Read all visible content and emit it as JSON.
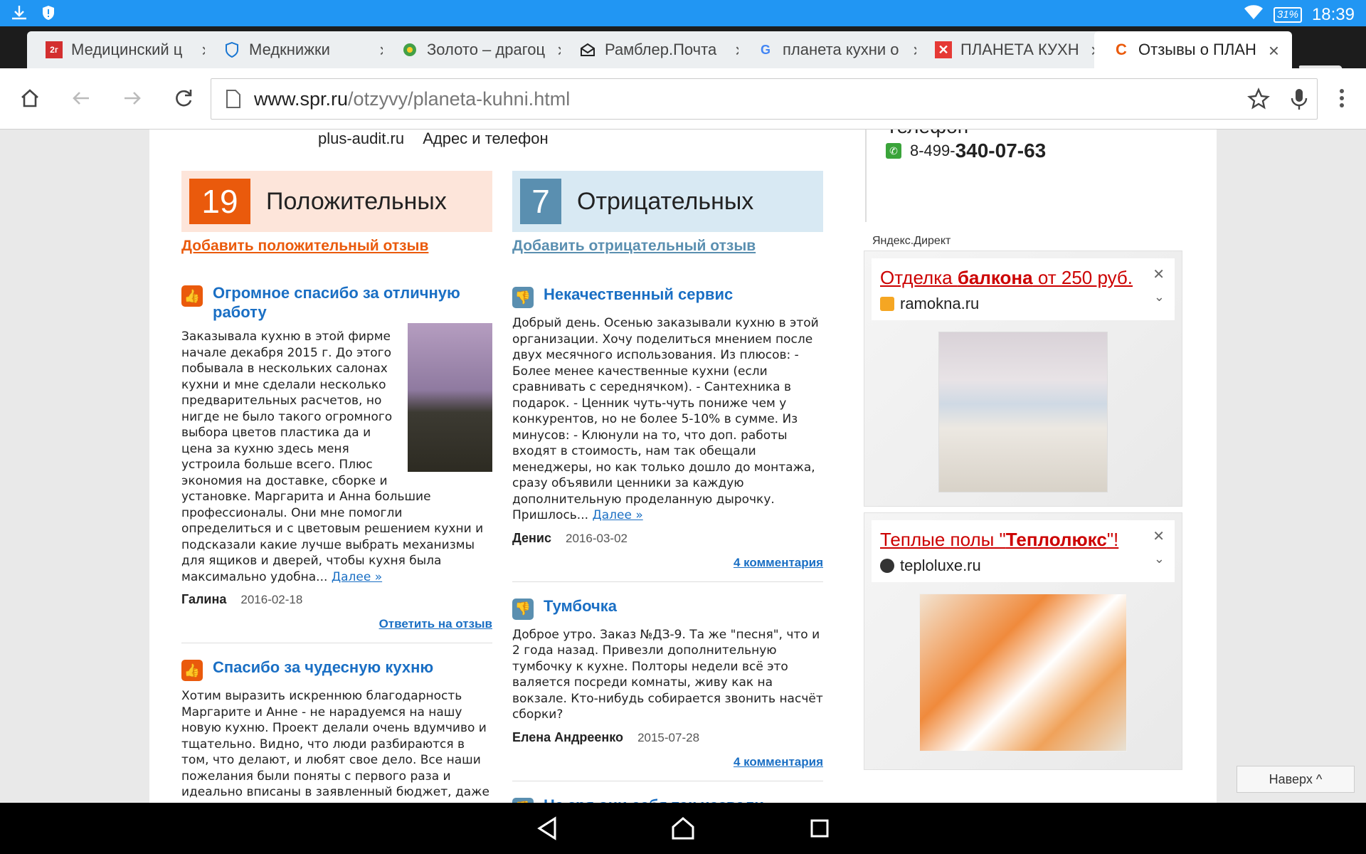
{
  "status": {
    "battery": "31%",
    "time": "18:39"
  },
  "tabs": [
    {
      "title": "Медицинский ц",
      "favicon": "google-2gis-icon"
    },
    {
      "title": "Медкнижки",
      "favicon": "shield-icon"
    },
    {
      "title": "Золото – драгоц",
      "favicon": "gold-icon"
    },
    {
      "title": "Рамблер.Почта",
      "favicon": "mail-icon"
    },
    {
      "title": "планета кухни о",
      "favicon": "google-icon"
    },
    {
      "title": "ПЛАНЕТА КУХН",
      "favicon": "red-x-icon"
    },
    {
      "title": "Отзывы о ПЛАН",
      "favicon": "spr-icon"
    }
  ],
  "omnibox": {
    "domain": "www.spr.ru",
    "path": "/otzyvy/planeta-kuhni.html"
  },
  "page": {
    "top_links": [
      "plus-audit.ru",
      "Адрес и телефон"
    ],
    "phone_label": "Телефон",
    "phone_prefix": "8-499-",
    "phone_main": "340-07-63",
    "positive": {
      "count": "19",
      "label": "Положительных",
      "add_link": "Добавить положительный отзыв"
    },
    "negative": {
      "count": "7",
      "label": "Отрицательных",
      "add_link": "Добавить отрицательный отзыв"
    },
    "positive_reviews": [
      {
        "title": "Огромное спасибо за отличную работу",
        "text": "Заказывала кухню в этой фирме начале декабря 2015 г. До этого побывала в нескольких салонах кухни и мне сделали несколько предварительных расчетов, но нигде не было такого огромного выбора цветов пластика да и цена за кухню здесь меня устроила больше всего. Плюс экономия на доставке, сборке и установке. Маргарита и Анна большие профессионалы. Они мне помогли определиться и с цветовым решением кухни и подсказали какие лучше выбрать механизмы для ящиков и дверей, чтобы кухня была максимально удобна...",
        "more": "Далее »",
        "author": "Галина",
        "date": "2016-02-18",
        "action": "Ответить на отзыв"
      },
      {
        "title": "Спасибо за чудесную кухню",
        "text": "Хотим выразить искреннюю благодарность Маргарите и Анне - не нарадуемся на нашу новую кухню. Проект делали очень вдумчиво и тщательно. Видно, что люди разбираются в том, что делают, и любят свое дело. Все наши пожелания были поняты с первого раза и идеально вписаны в заявленный бюджет, даже"
      }
    ],
    "negative_reviews": [
      {
        "title": "Некачественный сервис",
        "text": "Добрый день. Осенью заказывали кухню в этой организации. Хочу поделиться мнением после двух месячного использования. Из плюсов: - Более менее качественные кухни (если сравнивать с середнячком). - Сантехника в подарок. - Ценник чуть-чуть пониже чем у конкурентов, но не более 5-10% в сумме. Из минусов: - Клюнули на то, что доп. работы входят в стоимость, нам так обещали менеджеры, но как только дошло до монтажа, сразу объявили ценники за каждую дополнительную проделанную дырочку. Пришлось...",
        "more": "Далее »",
        "author": "Денис",
        "date": "2016-03-02",
        "action": "4 комментария"
      },
      {
        "title": "Тумбочка",
        "text": "Доброе утро. Заказ №ДЗ-9. Та же \"песня\", что и 2 года назад. Привезли дополнительную тумбочку к кухне. Полторы недели всё это валяется посреди комнаты, живу как на вокзале. Кто-нибудь собирается звонить насчёт сборки?",
        "author": "Елена Андреенко",
        "date": "2015-07-28",
        "action": "4 комментария"
      },
      {
        "title": "Не зря они себя так назвали"
      }
    ],
    "yandex_direct": "Яндекс.Директ",
    "ads": [
      {
        "title_pre": "Отделка ",
        "title_bold": "балкона",
        "title_post": " от 250 руб.",
        "domain": "ramokna.ru"
      },
      {
        "title_pre": "Теплые полы \"",
        "title_bold": "Теплолюкс",
        "title_post": "\"!",
        "domain": "teploluxe.ru"
      }
    ],
    "up_button": "Наверх ^"
  },
  "colors": {
    "status_bar": "#2196f3",
    "positive": "#ea5a0c",
    "positive_bg": "#fde5da",
    "negative": "#5a8fb0",
    "negative_bg": "#d8e9f3",
    "link": "#1a6fc4",
    "ad_title": "#cc0000"
  }
}
